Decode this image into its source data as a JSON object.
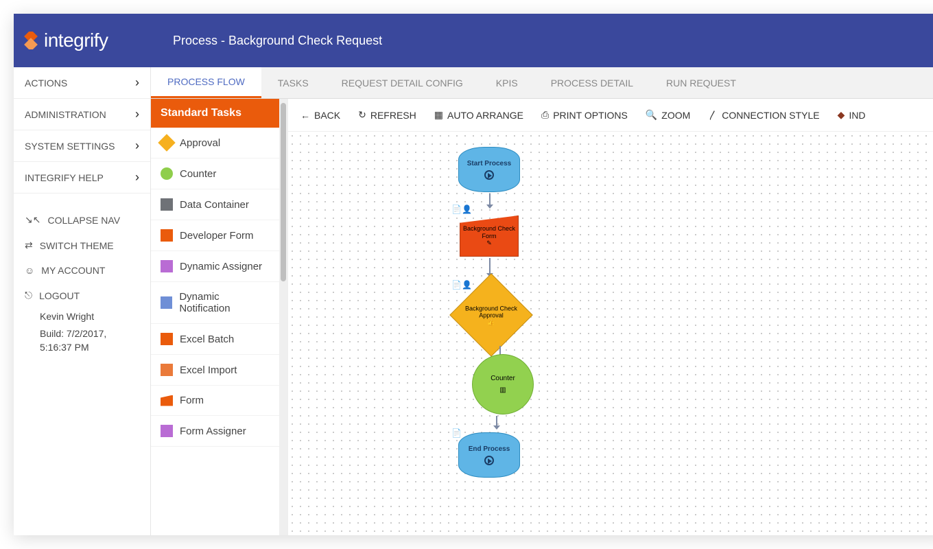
{
  "brand": "integrify",
  "header": {
    "title": "Process - Background Check Request"
  },
  "leftnav": {
    "primary": [
      "ACTIONS",
      "ADMINISTRATION",
      "SYSTEM SETTINGS",
      "INTEGRIFY HELP"
    ],
    "links": {
      "collapse": "COLLAPSE NAV",
      "theme": "SWITCH THEME",
      "account": "MY ACCOUNT",
      "logout": "LOGOUT"
    },
    "user": "Kevin Wright",
    "build": "Build: 7/2/2017, 5:16:37 PM"
  },
  "tabs": [
    "PROCESS FLOW",
    "TASKS",
    "REQUEST DETAIL CONFIG",
    "KPIS",
    "PROCESS DETAIL",
    "RUN REQUEST"
  ],
  "active_tab": 0,
  "palette": {
    "heading": "Standard Tasks",
    "items": [
      "Approval",
      "Counter",
      "Data Container",
      "Developer Form",
      "Dynamic Assigner",
      "Dynamic Notification",
      "Excel Batch",
      "Excel Import",
      "Form",
      "Form Assigner"
    ]
  },
  "toolbar": {
    "back": "BACK",
    "refresh": "REFRESH",
    "auto": "AUTO ARRANGE",
    "print": "PRINT OPTIONS",
    "zoom": "ZOOM",
    "conn": "CONNECTION STYLE",
    "ind": "IND"
  },
  "flow": {
    "start": "Start Process",
    "form": "Background Check Form",
    "approval": "Background Check Approval",
    "counter": "Counter",
    "end": "End Process"
  }
}
